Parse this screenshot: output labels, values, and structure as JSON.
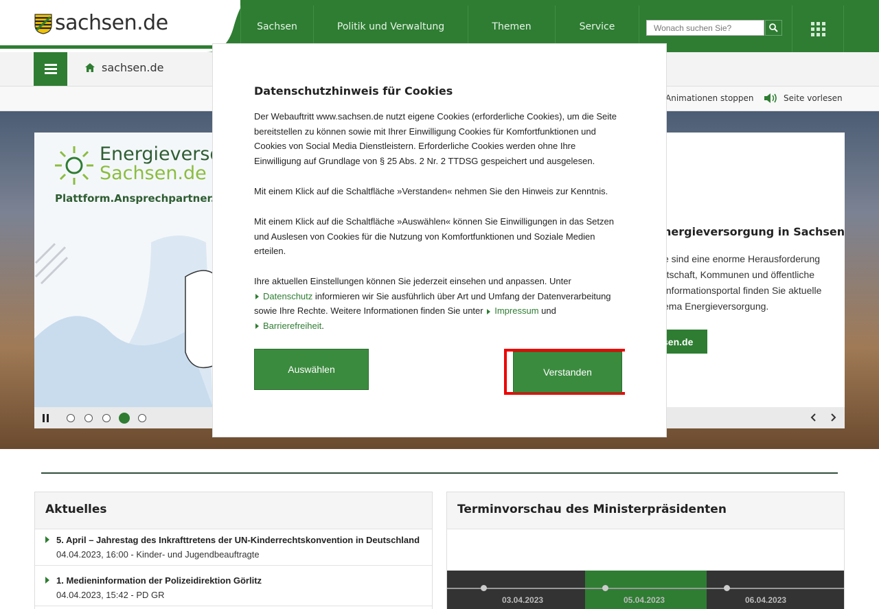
{
  "header": {
    "logo_text": "sachsen.de",
    "nav": [
      "Sachsen",
      "Politik und Verwaltung",
      "Themen",
      "Service"
    ],
    "search_placeholder": "Wonach suchen Sie?"
  },
  "subbar": {
    "breadcrumb_home": "sachsen.de"
  },
  "tools": {
    "stop_animations": "Animationen stoppen",
    "read_aloud": "Seite vorlesen"
  },
  "hero": {
    "image_title_1": "Energieversor",
    "image_title_2": "Sachsen.de",
    "image_tagline": "Plattform.Ansprechpartner.Inf",
    "title": "nergieversorgung in Sachsen",
    "text": "e sind eine enorme Herausforderung rtschaft, Kommunen und öffentliche Informationsportal finden Sie aktuelle ema Energieversorgung.",
    "link_label": "sen.de",
    "slides_count": 5,
    "active_slide": 4
  },
  "cookie_modal": {
    "title": "Datenschutzhinweis für Cookies",
    "p1": "Der Webauftritt www.sachsen.de nutzt eigene Cookies (erforderliche Cookies), um die Seite bereitstellen zu können sowie mit Ihrer Einwilligung Cookies für Komfortfunktionen und Cookies von Social Media Dienstleistern. Erforderliche Cookies werden ohne Ihre Einwilligung auf Grundlage von § 25 Abs. 2 Nr. 2 TTDSG gespeichert und ausgelesen.",
    "p2": "Mit einem Klick auf die Schaltfläche »Verstanden« nehmen Sie den Hinweis zur Kenntnis.",
    "p3": "Mit einem Klick auf die Schaltfläche »Auswählen« können Sie Einwilligungen in das Setzen und Auslesen von Cookies für die Nutzung von Komfortfunktionen und Soziale Medien erteilen.",
    "p4_start": "Ihre aktuellen Einstellungen können Sie jederzeit einsehen und anpassen. Unter",
    "link_privacy": "Datenschutz",
    "p4_mid": " informieren wir Sie ausführlich über Art und Umfang der Datenverarbeitung sowie Ihre Rechte. Weitere Informationen finden Sie unter",
    "link_imprint": "Impressum",
    "p4_and": " und",
    "link_accessibility": "Barrierefreiheit",
    "p4_end": ".",
    "btn_select": "Auswählen",
    "btn_accept": "Verstanden"
  },
  "news": {
    "heading": "Aktuelles",
    "items": [
      {
        "title": "5. April – Jahrestag des Inkrafttretens der UN-Kinderrechtskonvention in Deutschland",
        "meta": "04.04.2023, 16:00 - Kinder- und Jugendbeauftragte"
      },
      {
        "title": "1. Medieninformation der Polizeidirektion Görlitz",
        "meta": "04.04.2023, 15:42 - PD GR"
      }
    ]
  },
  "schedule": {
    "heading": "Terminvorschau des Ministerpräsidenten",
    "dates": [
      "03.04.2023",
      "05.04.2023",
      "06.04.2023"
    ]
  },
  "colors": {
    "brand_green": "#2e7d32",
    "highlight_red": "#e00000"
  }
}
